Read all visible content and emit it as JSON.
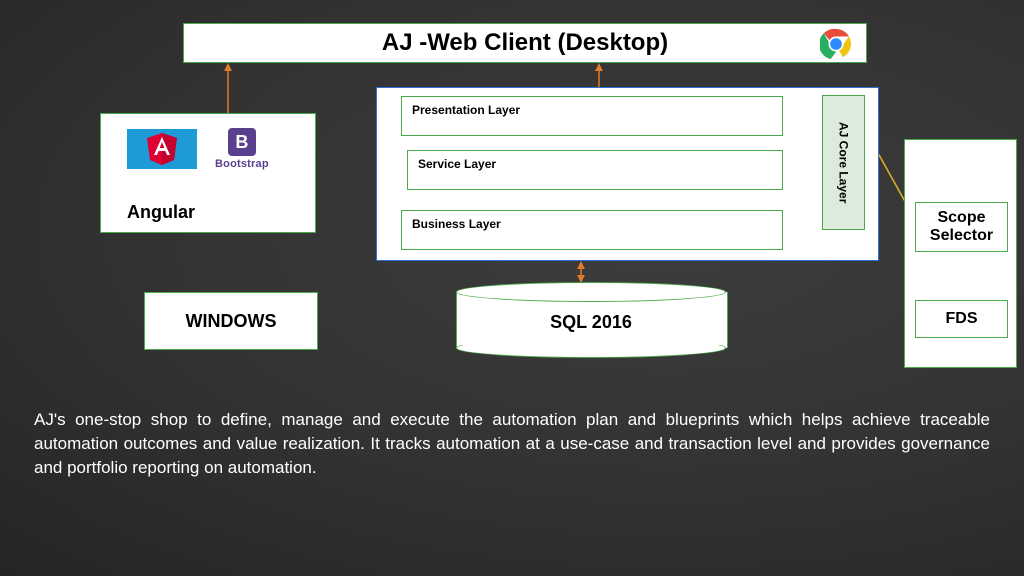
{
  "header": {
    "title": "AJ -Web Client (Desktop)"
  },
  "angular": {
    "label": "Angular",
    "bootstrap_name": "Bootstrap",
    "bootstrap_b": "B"
  },
  "layers": {
    "presentation": "Presentation Layer",
    "service": "Service Layer",
    "business": "Business Layer",
    "core": "AJ Core Layer"
  },
  "windows": {
    "label": "WINDOWS"
  },
  "sql": {
    "label": "SQL 2016"
  },
  "right": {
    "scope": "Scope Selector",
    "fds": "FDS"
  },
  "description": "AJ's one-stop shop to define, manage and execute the automation plan and blueprints which helps achieve traceable automation outcomes and value realization. It tracks automation at a use-case and transaction level and provides governance and portfolio reporting on automation."
}
